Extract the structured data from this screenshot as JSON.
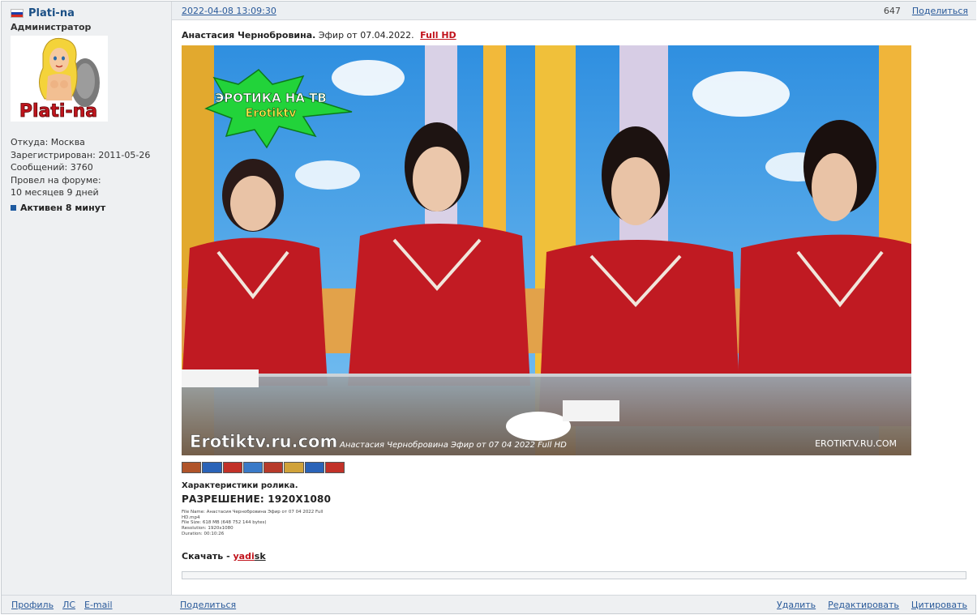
{
  "user": {
    "name": "Plati-na",
    "rank": "Администратор",
    "avatar_text": "Plati-na",
    "location_label": "Откуда:",
    "location": "Москва",
    "registered_label": "Зарегистрирован:",
    "registered": "2011-05-26",
    "messages_label": "Сообщений:",
    "messages": "3760",
    "forum_time_label": "Провел на форуме:",
    "forum_time": "10 месяцев 9 дней",
    "status": "Активен 8 минут"
  },
  "post": {
    "date": "2022-04-08 13:09:30",
    "views": "647",
    "share_label": "Поделиться",
    "title_bold": "Анастасия Чернобровина.",
    "title_rest": "Эфир от 07.04.2022.",
    "title_quality": "Full HD",
    "image": {
      "logo_line1": "ЭРОТИКА НА ТВ",
      "logo_line2": "Erotiktv",
      "watermark_left": "Erotiktv.ru.com",
      "caption": "Анастасия Чернобровина Эфир от 07 04 2022 Full HD",
      "watermark_right": "EROTIKTV.RU.COM"
    },
    "specs_title": "Характеристики ролика.",
    "resolution": "РАЗРЕШЕНИЕ: 1920X1080",
    "mediainfo": [
      "File Name: Анастасия Чернобровина Эфир от 07 04 2022 Full HD.mp4",
      "File Size: 618 MB (648 752 144 bytes)",
      "Resolution: 1920x1080",
      "Duration: 00:10:26"
    ],
    "download_label": "Скачать -",
    "download_link_a": "yadi",
    "download_link_b": "sk"
  },
  "footer": {
    "profile": "Профиль",
    "pm": "ЛС",
    "email": "E-mail",
    "share": "Поделиться",
    "delete": "Удалить",
    "edit": "Редактировать",
    "quote": "Цитировать"
  },
  "colors": {
    "link": "#2a5a9a",
    "username": "#1a4f85",
    "accent_red": "#c1121b",
    "panel_bg": "#eef0f2"
  }
}
